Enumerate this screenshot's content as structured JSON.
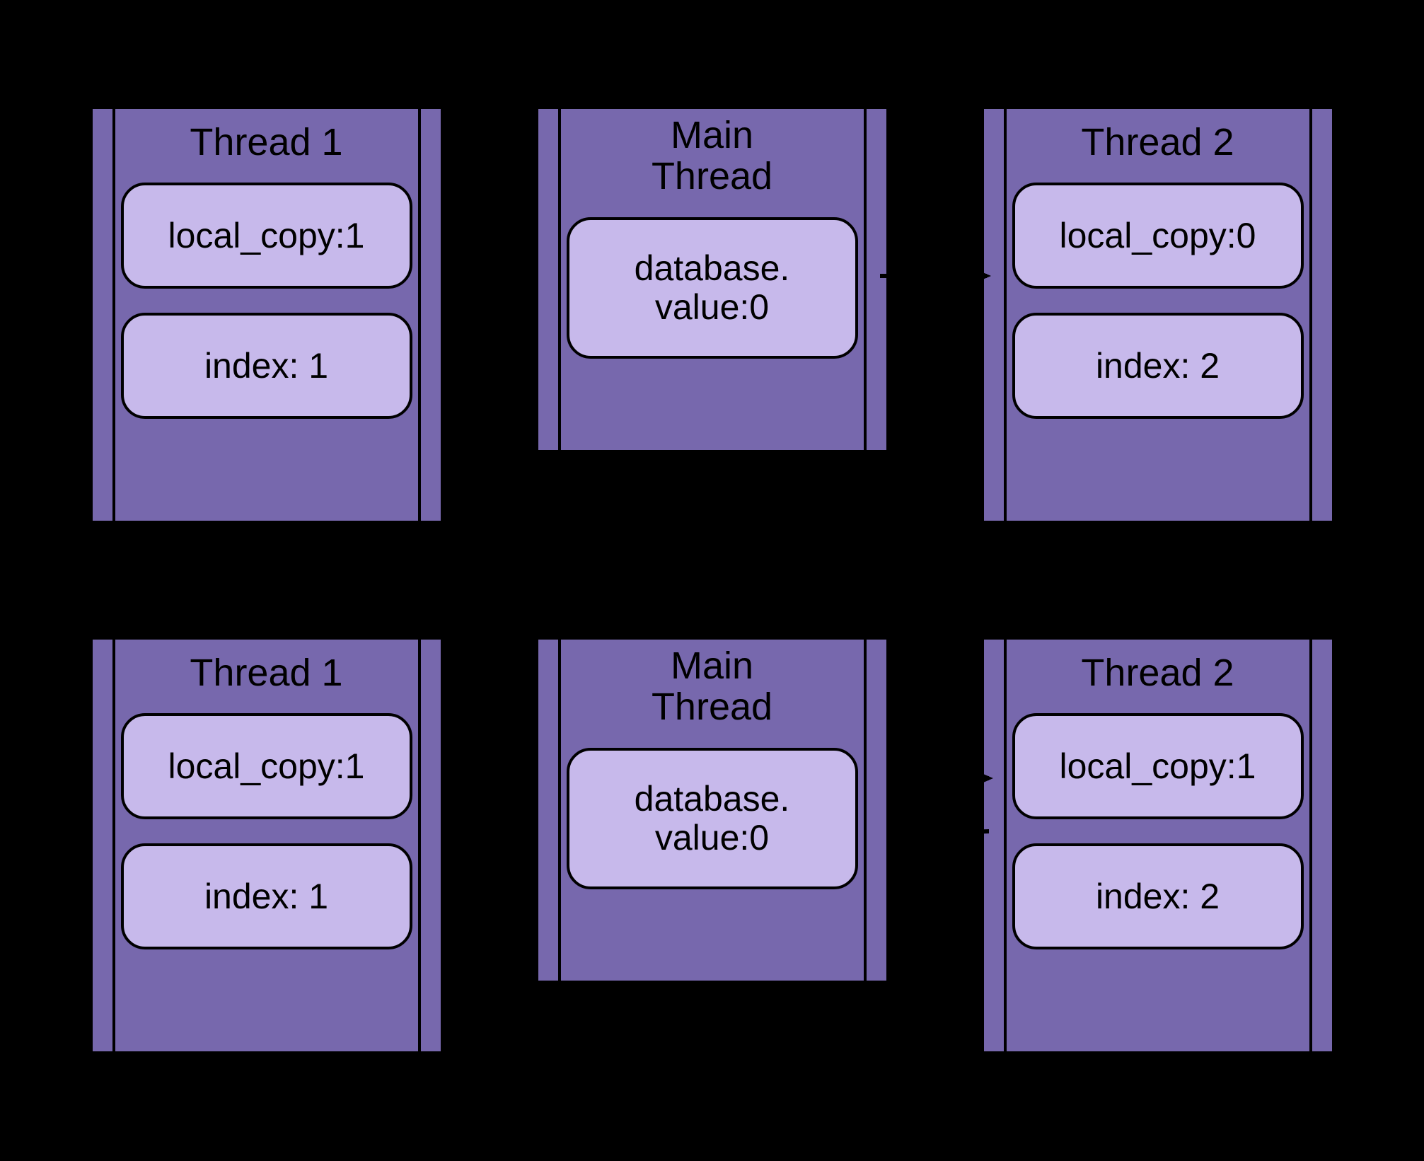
{
  "row1": {
    "thread1": {
      "title": "Thread 1",
      "local_copy": "local_copy:1",
      "index": "index: 1"
    },
    "main": {
      "title": "Main\nThread",
      "db": "database.\nvalue:0"
    },
    "thread2": {
      "title": "Thread 2",
      "local_copy": "local_copy:0",
      "index": "index: 2"
    }
  },
  "row2": {
    "thread1": {
      "title": "Thread 1",
      "local_copy": "local_copy:1",
      "index": "index: 1"
    },
    "main": {
      "title": "Main\nThread",
      "db": "database.\nvalue:0"
    },
    "thread2": {
      "title": "Thread 2",
      "local_copy": "local_copy:1",
      "index": "index: 2"
    }
  }
}
